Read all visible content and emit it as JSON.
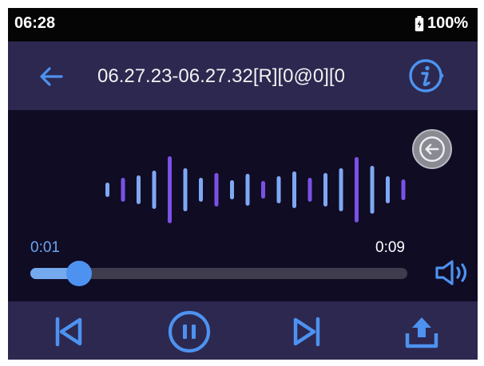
{
  "status_bar": {
    "time": "06:28",
    "battery_percent": "100%"
  },
  "header": {
    "title": "06.27.23-06.27.32[R][0@0][0"
  },
  "player": {
    "elapsed": "0:01",
    "duration": "0:09",
    "progress_fraction": 0.13
  },
  "controls": {
    "items": [
      "skip-previous-icon",
      "pause-icon",
      "skip-next-icon",
      "share-upload-icon"
    ]
  },
  "icons": {
    "back": "arrow-left-icon",
    "info": "info-icon",
    "collapse": "arrow-left-circle-icon",
    "volume": "speaker-icon"
  },
  "colors": {
    "accent": "#4d92f0",
    "wave_blue": "#7ea8f3",
    "wave_purple": "#7a52e6",
    "panel": "#2c2850",
    "player_bg": "#100c24"
  }
}
